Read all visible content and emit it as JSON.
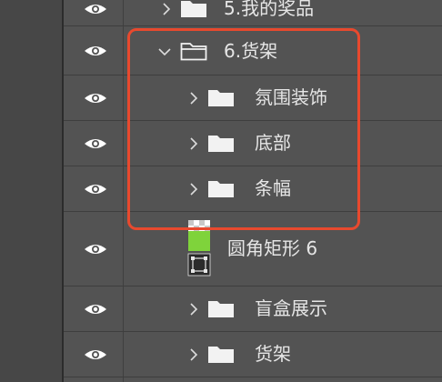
{
  "layers": [
    {
      "id": "row-0",
      "label": "5.我的奖品",
      "kind": "group",
      "expanded": false,
      "icon": "eye-icon"
    },
    {
      "id": "row-1",
      "label": "6.货架",
      "kind": "group",
      "expanded": true,
      "icon": "eye-icon"
    },
    {
      "id": "row-2",
      "label": "氛围装饰",
      "kind": "group",
      "expanded": false,
      "icon": "eye-icon"
    },
    {
      "id": "row-3",
      "label": "底部",
      "kind": "group",
      "expanded": false,
      "icon": "eye-icon"
    },
    {
      "id": "row-4",
      "label": "条幅",
      "kind": "group",
      "expanded": false,
      "icon": "eye-icon"
    },
    {
      "id": "row-5",
      "label": "圆角矩形 6",
      "kind": "shape",
      "icon": "eye-icon"
    },
    {
      "id": "row-6",
      "label": "盲盒展示",
      "kind": "group",
      "expanded": false,
      "icon": "eye-icon"
    },
    {
      "id": "row-7",
      "label": "货架",
      "kind": "group",
      "expanded": false,
      "icon": "eye-icon"
    }
  ],
  "colors": {
    "panel_bg": "#535353",
    "text": "#e6e6e6",
    "highlight_border": "#e8492e",
    "shape_fill": "#7fd33b"
  }
}
